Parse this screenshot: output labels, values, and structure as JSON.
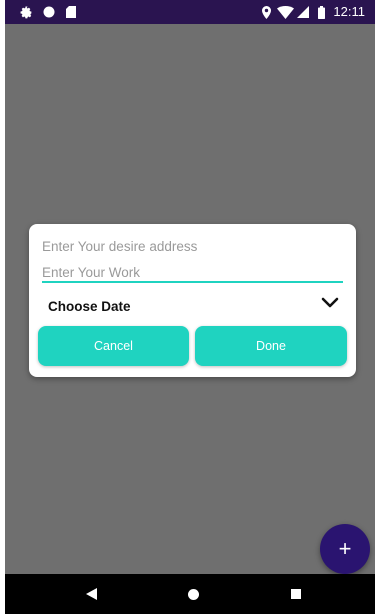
{
  "status_bar": {
    "time": "12:11",
    "left_icons": [
      "settings-icon",
      "circle-icon",
      "sd-card-icon"
    ],
    "right_icons": [
      "location-icon",
      "wifi-icon",
      "signal-icon",
      "battery-icon"
    ]
  },
  "dialog": {
    "address_placeholder": "Enter Your desire address",
    "work_placeholder": "Enter Your Work",
    "choose_date_label": "Choose Date",
    "cancel_label": "Cancel",
    "done_label": "Done"
  },
  "fab": {
    "label": "+"
  },
  "nav": {
    "buttons": [
      "back-icon",
      "home-icon",
      "recents-icon"
    ]
  },
  "colors": {
    "accent": "#1fd3c0",
    "status_bar": "#2a1450",
    "fab": "#2a1470",
    "scrim": "#6f6f6f"
  }
}
